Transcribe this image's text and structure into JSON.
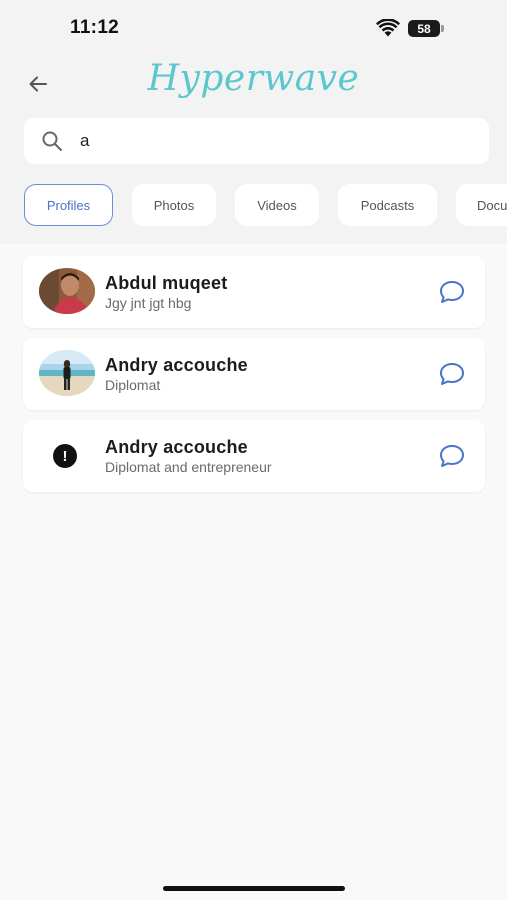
{
  "status_bar": {
    "time": "11:12",
    "battery": "58"
  },
  "header": {
    "logo": "Hyperwave"
  },
  "search": {
    "value": "a",
    "placeholder": ""
  },
  "chips": [
    {
      "label": "Profiles"
    },
    {
      "label": "Photos"
    },
    {
      "label": "Videos"
    },
    {
      "label": "Podcasts"
    },
    {
      "label": "Docu"
    }
  ],
  "results": [
    {
      "name": "Abdul muqeet",
      "subtitle": "Jgy jnt jgt hbg"
    },
    {
      "name": "Andry accouche",
      "subtitle": "Diplomat"
    },
    {
      "name": "Andry accouche",
      "subtitle": "Diplomat and entrepreneur"
    }
  ],
  "colors": {
    "accent": "#5cc7cd",
    "chip_active": "#4a72c9",
    "chat_icon": "#4a72c9"
  }
}
